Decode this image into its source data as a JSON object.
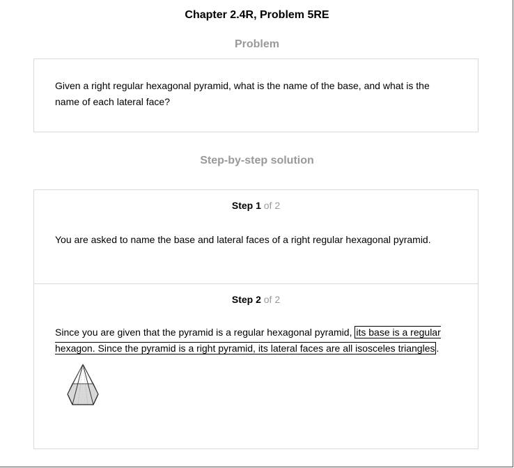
{
  "page": {
    "title": "Chapter 2.4R, Problem 5RE"
  },
  "problem": {
    "heading": "Problem",
    "text": "Given a right regular hexagonal pyramid, what is the name of the base, and what is the name of each lateral face?"
  },
  "solution": {
    "heading": "Step-by-step solution",
    "steps": [
      {
        "label": "Step 1",
        "of": "of 2",
        "text": "You are asked to name the base and lateral faces of a right regular hexagonal pyramid."
      },
      {
        "label": "Step 2",
        "of": "of 2",
        "text_plain": "Since you are given that the pyramid is a regular hexagonal pyramid, ",
        "text_boxed": "its base is a regular hexagon. Since the pyramid is a right pyramid, its lateral faces are all isosceles triangles",
        "text_end": ".",
        "figure_icon": "hexagonal-pyramid-figure"
      }
    ]
  }
}
